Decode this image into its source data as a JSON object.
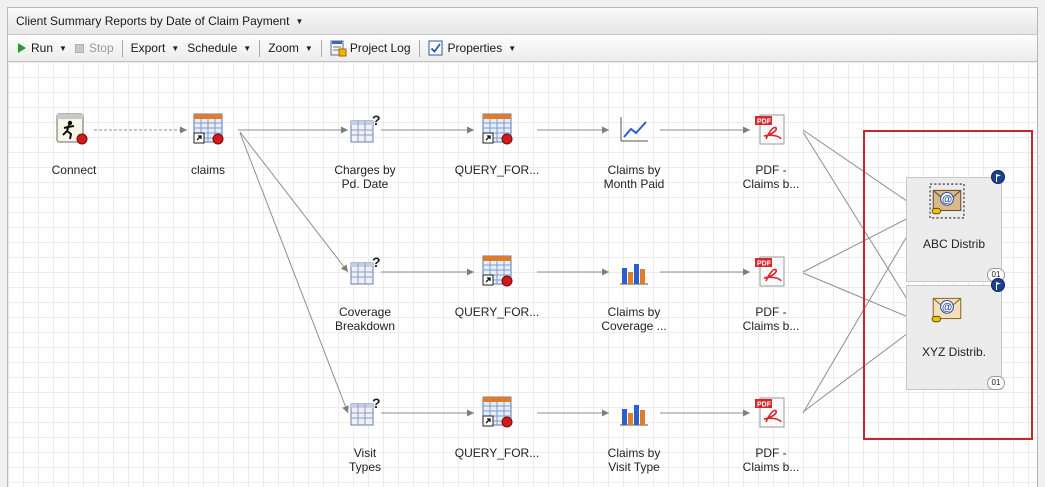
{
  "window": {
    "title": "Client Summary Reports by Date of Claim Payment"
  },
  "toolbar": {
    "run_label": "Run",
    "stop_label": "Stop",
    "export_label": "Export",
    "schedule_label": "Schedule",
    "zoom_label": "Zoom",
    "project_log_label": "Project Log",
    "properties_label": "Properties"
  },
  "flow": {
    "connect": "Connect",
    "claims": "claims",
    "rows": [
      {
        "task": "Charges by\nPd. Date",
        "query": "QUERY_FOR...",
        "graph": "Claims by\nMonth Paid",
        "pdf": "PDF -\nClaims b..."
      },
      {
        "task": "Coverage\nBreakdown",
        "query": "QUERY_FOR...",
        "graph": "Claims by\nCoverage ...",
        "pdf": "PDF -\nClaims b..."
      },
      {
        "task": "Visit\nTypes",
        "query": "QUERY_FOR...",
        "graph": "Claims by\nVisit Type",
        "pdf": "PDF -\nClaims b..."
      }
    ],
    "distributions": [
      {
        "label": "ABC Distrib",
        "badge": "01"
      },
      {
        "label": "XYZ Distrib.",
        "badge": "01"
      }
    ]
  },
  "pdf_icon_text": "PDF",
  "icons": {
    "connect": "connect-runner-icon",
    "data": "dataset-table-icon",
    "task": "task-grid-question-icon",
    "line_graph": "line-chart-icon",
    "bar_graph": "bar-chart-icon",
    "pdf": "pdf-document-icon",
    "email": "email-distribution-icon",
    "flag": "flag-icon"
  },
  "colors": {
    "highlight_box": "#c4272e",
    "pdf_red": "#d8262b",
    "run_green": "#2c9a2c"
  }
}
